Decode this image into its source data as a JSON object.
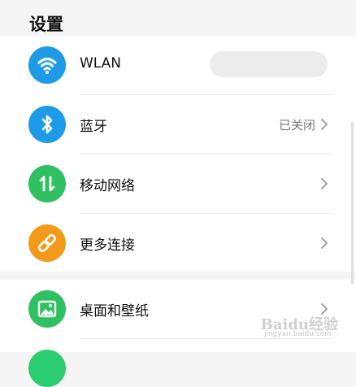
{
  "page": {
    "title": "设置"
  },
  "rows": [
    {
      "label": "WLAN",
      "value": "",
      "icon": "wifi-icon",
      "color": "#1e9be6"
    },
    {
      "label": "蓝牙",
      "value": "已关闭",
      "icon": "bluetooth-icon",
      "color": "#1e9be6"
    },
    {
      "label": "移动网络",
      "value": "",
      "icon": "mobile-data-icon",
      "color": "#2ec061"
    },
    {
      "label": "更多连接",
      "value": "",
      "icon": "link-icon",
      "color": "#f39a1b"
    },
    {
      "label": "桌面和壁纸",
      "value": "",
      "icon": "wallpaper-icon",
      "color": "#2ec061"
    }
  ],
  "watermark": {
    "text": "Baidu经验",
    "sub": "jingyan.baidu.com"
  }
}
